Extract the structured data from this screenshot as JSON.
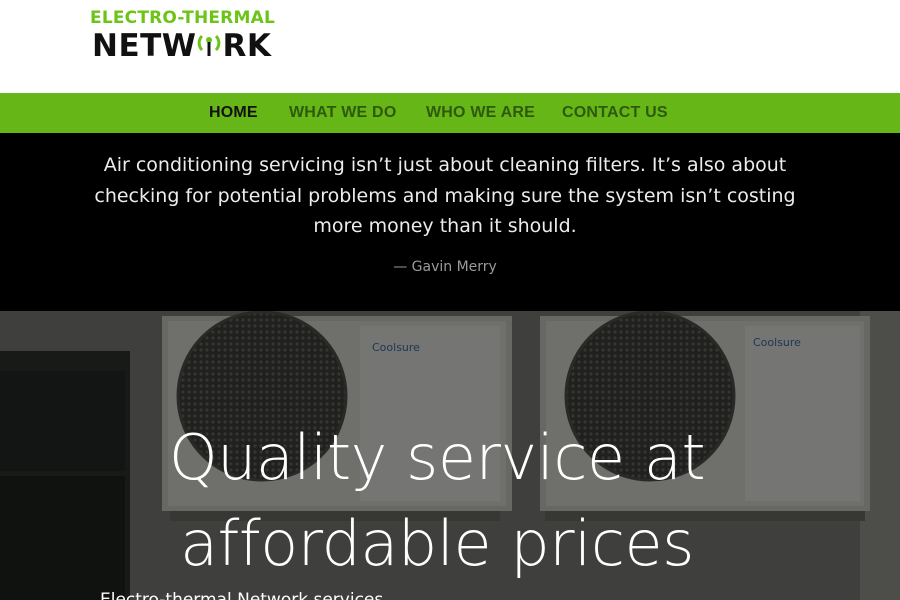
{
  "logo": {
    "line1": "ELECTRO-THERMAL",
    "line2_left": "NETW",
    "line2_right": "RK"
  },
  "nav": {
    "items": [
      {
        "label": "HOME",
        "active": true
      },
      {
        "label": "WHAT WE DO",
        "active": false
      },
      {
        "label": "WHO WE ARE",
        "active": false
      },
      {
        "label": "CONTACT US",
        "active": false
      }
    ]
  },
  "quote": {
    "text": "Air conditioning servicing isn’t just about cleaning filters. It’s also about checking for potential problems and making sure the system isn’t costing more money than it should.",
    "author": "— Gavin Merry"
  },
  "hero": {
    "title_line1": "Quality service at",
    "title_line2": "affordable prices",
    "unit_brand": "Coolsure",
    "subtitle": "Electro-thermal Network services …"
  },
  "colors": {
    "brand_green": "#67b617",
    "logo_green": "#6cc417",
    "nav_text": "#2d5a0b",
    "quote_bg": "#000000"
  }
}
